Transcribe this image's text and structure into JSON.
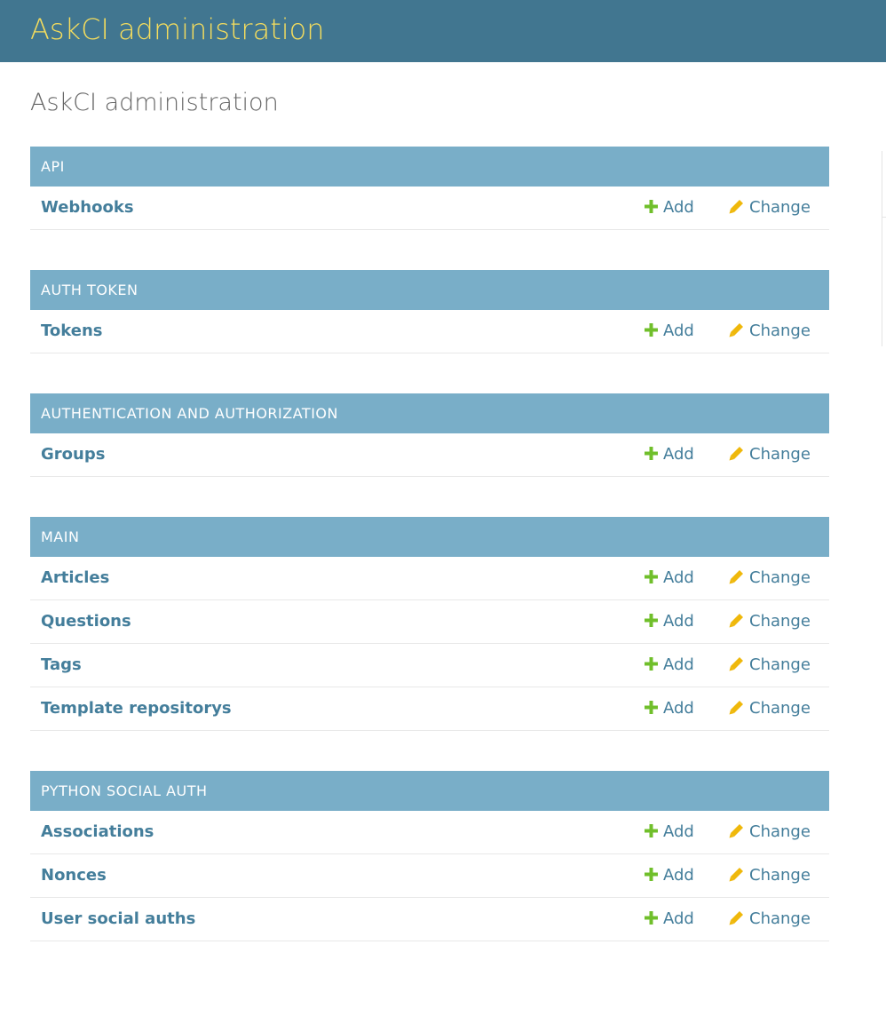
{
  "header": {
    "branding": "AskCI administration"
  },
  "page_title": "AskCI administration",
  "action_labels": {
    "add": "Add",
    "change": "Change"
  },
  "colors": {
    "header_bg": "#417690",
    "branding": "#f5dd5d",
    "caption_bg": "#79aec8",
    "link": "#447e9b",
    "add_icon": "#70bf2b",
    "change_icon": "#efb80b"
  },
  "icons": {
    "add": "plus-icon",
    "change": "pencil-icon"
  },
  "modules": [
    {
      "caption": "API",
      "models": [
        "Webhooks"
      ]
    },
    {
      "caption": "AUTH TOKEN",
      "models": [
        "Tokens"
      ]
    },
    {
      "caption": "AUTHENTICATION AND AUTHORIZATION",
      "models": [
        "Groups"
      ]
    },
    {
      "caption": "MAIN",
      "models": [
        "Articles",
        "Questions",
        "Tags",
        "Template repositorys"
      ]
    },
    {
      "caption": "PYTHON SOCIAL AUTH",
      "models": [
        "Associations",
        "Nonces",
        "User social auths"
      ]
    }
  ]
}
